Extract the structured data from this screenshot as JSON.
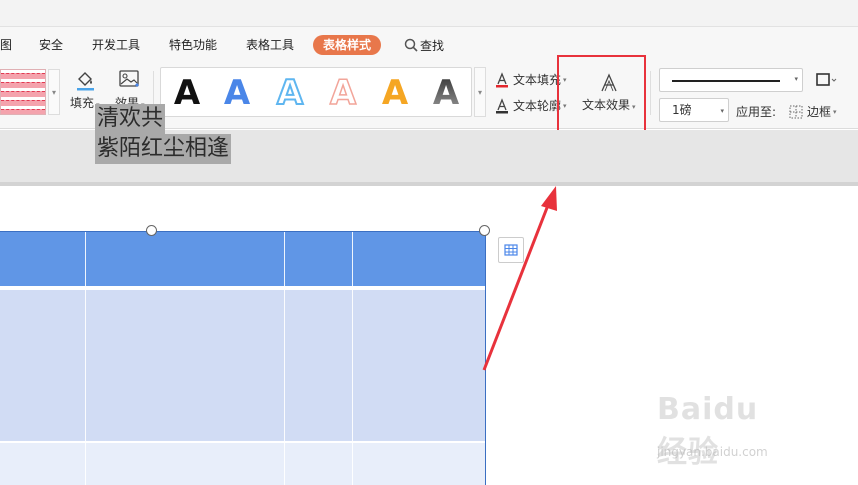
{
  "tabs": {
    "view": "图",
    "security": "安全",
    "developer": "开发工具",
    "features": "特色功能",
    "table_tools": "表格工具",
    "table_style": "表格样式",
    "search": "查找"
  },
  "ribbon": {
    "fill_label": "填充",
    "effect_label": "效果",
    "text_styles": [
      {
        "glyph": "A",
        "color": "#111111"
      },
      {
        "glyph": "A",
        "color": "#4a86e8"
      },
      {
        "glyph": "A",
        "color": "#5fb6f0"
      },
      {
        "glyph": "A",
        "color": "#f2a59a"
      },
      {
        "glyph": "A",
        "color": "#f5a623"
      },
      {
        "glyph": "A",
        "color": "#555555"
      }
    ],
    "text_fill_label": "文本填充",
    "text_outline_label": "文本轮廓",
    "text_effect_label": "文本效果",
    "line_weight": "1磅",
    "apply_to_label": "应用至:",
    "border_label": "边框"
  },
  "document": {
    "cell_line1": "清欢共",
    "cell_line2": "紫陌红尘相逢"
  },
  "watermark": {
    "brand": "Baidu经验",
    "url": "jingyan.baidu.com"
  },
  "colors": {
    "active_tab": "#e8774b",
    "table_header": "#6096e6",
    "table_band": "#d1dcf4",
    "highlight": "#e8323c"
  }
}
